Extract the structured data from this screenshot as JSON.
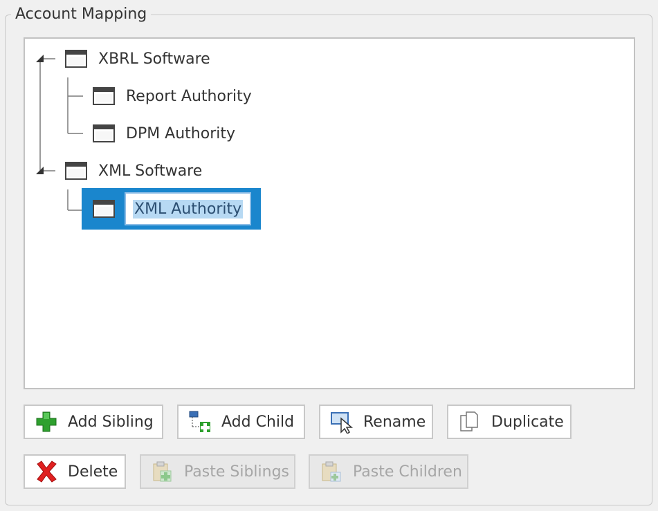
{
  "group": {
    "title": "Account Mapping"
  },
  "tree": {
    "nodes": [
      {
        "label": "XBRL Software",
        "level": 0,
        "expanded": true
      },
      {
        "label": "Report Authority",
        "level": 1
      },
      {
        "label": "DPM Authority",
        "level": 1
      },
      {
        "label": "XML Software",
        "level": 0,
        "expanded": true
      },
      {
        "label": "XML Authority",
        "level": 1,
        "selected": true,
        "editing": true
      }
    ]
  },
  "buttons": {
    "add_sibling": {
      "label": "Add Sibling",
      "icon": "green-plus-icon"
    },
    "add_child": {
      "label": "Add Child",
      "icon": "add-child-icon"
    },
    "rename": {
      "label": "Rename",
      "icon": "rename-cursor-icon"
    },
    "duplicate": {
      "label": "Duplicate",
      "icon": "duplicate-pages-icon"
    },
    "delete": {
      "label": "Delete",
      "icon": "red-x-icon"
    },
    "paste_siblings": {
      "label": "Paste Siblings",
      "icon": "paste-sibling-icon",
      "enabled": false
    },
    "paste_children": {
      "label": "Paste Children",
      "icon": "paste-child-icon",
      "enabled": false
    }
  },
  "colors": {
    "selection": "#1a86cd",
    "delete_red": "#e02020",
    "add_green": "#2ea02e"
  }
}
